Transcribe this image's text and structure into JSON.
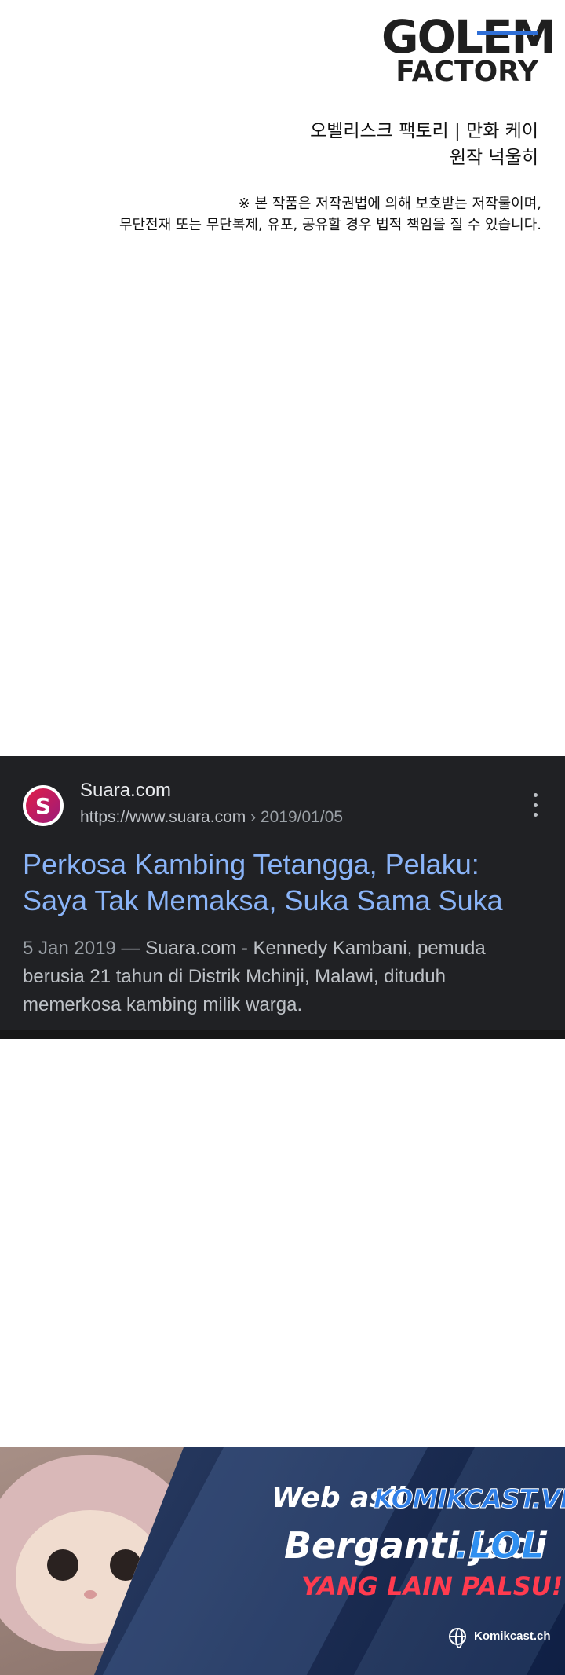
{
  "header": {
    "logo_line1": "GOLEM",
    "logo_line2": "FACTORY"
  },
  "credits": {
    "line1": "오벨리스크 팩토리  | 만화 케이",
    "line2": "원작 넉울히"
  },
  "notice": {
    "line1": "※ 본 작품은 저작권법에 의해 보호받는 저작물이며,",
    "line2": "무단전재 또는 무단복제, 유포, 공유할 경우 법적 책임을 질 수 있습니다."
  },
  "result": {
    "favicon_letter": "S",
    "site_name": "Suara.com",
    "url_domain": "https://www.suara.com",
    "url_path": " › 2019/01/05",
    "title": "Perkosa Kambing Tetangga, Pelaku: Saya Tak Memaksa, Suka Sama Suka",
    "date": "5 Jan 2019 — ",
    "snippet": "Suara.com - Kennedy Kambani, pemuda berusia 21 tahun di Distrik Mchinji, Malawi, dituduh memerkosa kambing milik warga.",
    "more_icon": "more-vert-icon",
    "title_color": "#8ab4f8"
  },
  "banner": {
    "line1a": "Web asli",
    "line1b": "KOMIKCAST.VIP",
    "line2a": "Berganti jadi",
    "line2b": ".LOL",
    "line3": "YANG LAIN PALSU!",
    "site": "Komikcast.ch",
    "accent_color": "#2f7fe8",
    "warning_color": "#ff3b4f"
  }
}
